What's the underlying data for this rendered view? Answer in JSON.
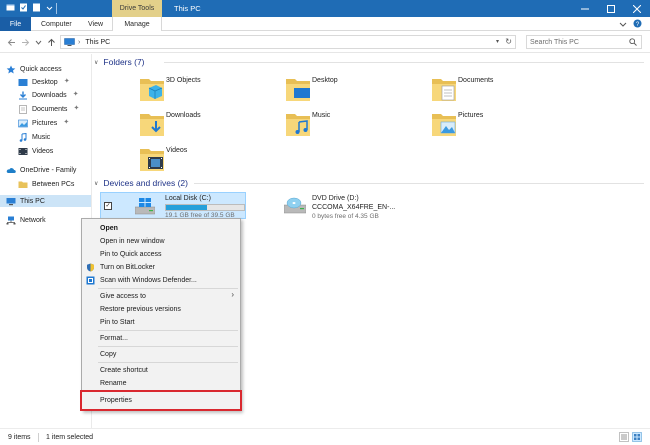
{
  "window": {
    "title": "This PC",
    "context_tab_header": "Drive Tools"
  },
  "ribbon": {
    "tabs": [
      "File",
      "Computer",
      "View",
      "Manage"
    ]
  },
  "address": {
    "path": "This PC",
    "search_placeholder": "Search This PC"
  },
  "navpane": {
    "items": [
      {
        "label": "Quick access"
      },
      {
        "label": "Desktop"
      },
      {
        "label": "Downloads"
      },
      {
        "label": "Documents"
      },
      {
        "label": "Pictures"
      },
      {
        "label": "Music"
      },
      {
        "label": "Videos"
      },
      {
        "label": "OneDrive - Family"
      },
      {
        "label": "Between PCs"
      },
      {
        "label": "This PC"
      },
      {
        "label": "Network"
      }
    ]
  },
  "content": {
    "folders_header": "Folders (7)",
    "folders": [
      "3D Objects",
      "Desktop",
      "Documents",
      "Downloads",
      "Music",
      "Pictures",
      "Videos"
    ],
    "devices_header": "Devices and drives (2)",
    "drives": [
      {
        "name": "Local Disk (C:)",
        "free": "19.1 GB free of 39.5 GB",
        "used_fraction": 0.52
      },
      {
        "name": "DVD Drive (D:)",
        "label": "CCCOMA_X64FRE_EN-...",
        "free": "0 bytes free of 4.35 GB"
      }
    ]
  },
  "context_menu": {
    "items": [
      "Open",
      "Open in new window",
      "Pin to Quick access",
      "Turn on BitLocker",
      "Scan with Windows Defender...",
      "Give access to",
      "Restore previous versions",
      "Pin to Start",
      "Format...",
      "Copy",
      "Create shortcut",
      "Rename",
      "Properties"
    ]
  },
  "status": {
    "count": "9 items",
    "selected": "1 item selected"
  },
  "colors": {
    "titlebar": "#1f6cb5",
    "context_tab": "#e3d08a",
    "selection": "#cce8ff",
    "highlight_box": "#d9282f",
    "group_header": "#1e3287"
  }
}
